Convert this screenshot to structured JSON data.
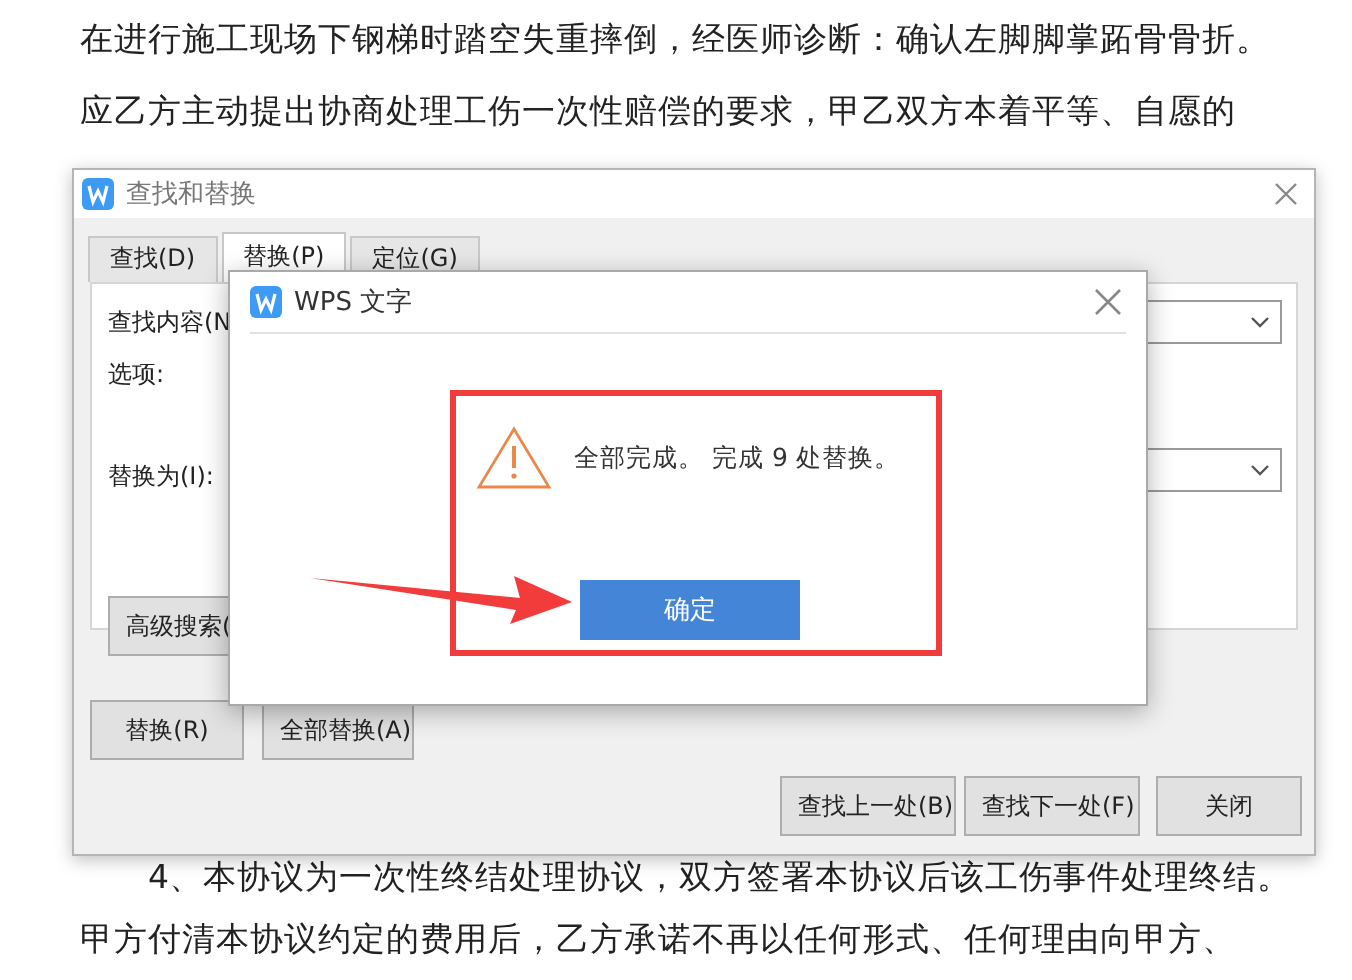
{
  "document": {
    "paragraphs_top": [
      "在进行施工现场下钢梯时踏空失重摔倒，经医师诊断：确认左脚脚掌跖骨骨折。",
      "应乙方主动提出协商处理工伤一次性赔偿的要求，甲乙双方本着平等、自愿的"
    ],
    "paragraphs_bottom": [
      {
        "text": "4、本协议为一次性终结处理协议，双方签署本协议后该工伤事件处理终结。",
        "indent": true
      },
      {
        "text": "甲方付清本协议约定的费用后，乙方承诺不再以任何形式、任何理由向甲方、",
        "indent": false
      }
    ]
  },
  "find_replace_dialog": {
    "title": "查找和替换",
    "tabs": [
      {
        "label": "查找(D)",
        "selected": false
      },
      {
        "label": "替换(P)",
        "selected": true
      },
      {
        "label": "定位(G)",
        "selected": false
      }
    ],
    "find_label": "查找内容(N",
    "options_label": "选项:",
    "replace_label": "替换为(I):",
    "advanced_button": "高级搜索(",
    "replace_button": "替换(R)",
    "replace_all_button": "全部替换(A)",
    "find_prev_button": "查找上一处(B)",
    "find_next_button": "查找下一处(F)",
    "close_button": "关闭"
  },
  "message_dialog": {
    "title": "WPS 文字",
    "message": "全部完成。 完成 9 处替换。",
    "ok_button": "确定"
  }
}
